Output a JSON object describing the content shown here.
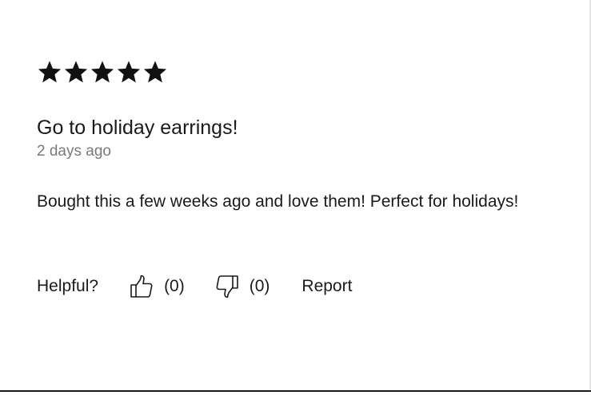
{
  "review": {
    "rating": 5,
    "rating_max": 5,
    "title": "Go to holiday earrings!",
    "date": "2 days ago",
    "body": "Bought this a few weeks ago and love them! Perfect for holidays!"
  },
  "actions": {
    "helpful_label": "Helpful?",
    "upvote_count": "(0)",
    "downvote_count": "(0)",
    "report_label": "Report"
  },
  "icons": {
    "star": "star-icon",
    "thumbs_up": "thumbs-up-icon",
    "thumbs_down": "thumbs-down-icon"
  },
  "colors": {
    "text": "#1a1a1a",
    "muted": "#7a7a7a",
    "star": "#111111"
  }
}
